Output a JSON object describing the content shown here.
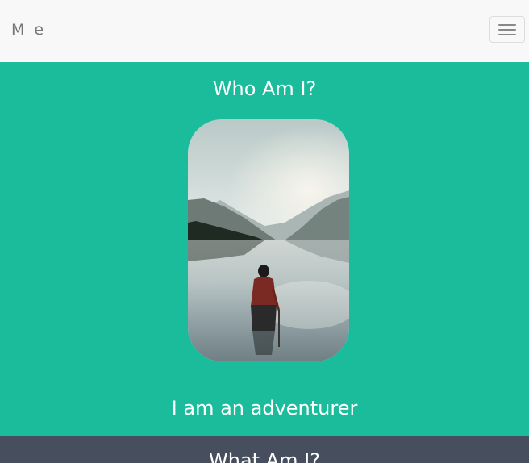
{
  "navbar": {
    "brand": "M e",
    "toggle_icon": "hamburger-menu-icon"
  },
  "hero": {
    "title": "Who Am I?",
    "photo_subject": "person standing in lake with mountains",
    "caption": "I am an adventurer",
    "background_color": "#1abc9c"
  },
  "section2": {
    "title": "What Am I?",
    "background_color": "#474e5d"
  }
}
